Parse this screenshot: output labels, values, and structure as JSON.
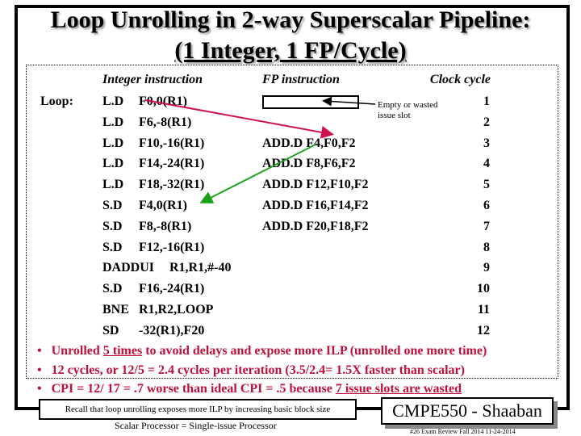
{
  "title_line1": "Loop Unrolling in 2-way Superscalar Pipeline:",
  "title_line2": "(1 Integer, 1 FP/Cycle)",
  "headers": {
    "integer": "Integer instruction",
    "fp": "FP instruction",
    "cycle": "Clock cycle"
  },
  "loop_label": "Loop:",
  "rows": [
    {
      "op": "L.D",
      "args": "F0,0(R1)",
      "fp": "",
      "cycle": "1"
    },
    {
      "op": "L.D",
      "args": "F6,-8(R1)",
      "fp": "",
      "cycle": "2"
    },
    {
      "op": "L.D",
      "args": "F10,-16(R1)",
      "fp": "ADD.D F4,F0,F2",
      "cycle": "3"
    },
    {
      "op": "L.D",
      "args": "F14,-24(R1)",
      "fp": "ADD.D F8,F6,F2",
      "cycle": "4"
    },
    {
      "op": "L.D",
      "args": "F18,-32(R1)",
      "fp": "ADD.D F12,F10,F2",
      "cycle": "5"
    },
    {
      "op": "S.D",
      "args": "F4,0(R1)",
      "fp": "ADD.D F16,F14,F2",
      "cycle": "6"
    },
    {
      "op": "S.D",
      "args": "F8,-8(R1)",
      "fp": "ADD.D F20,F18,F2",
      "cycle": "7"
    },
    {
      "op": "S.D",
      "args": "F12,-16(R1)",
      "fp": "",
      "cycle": "8"
    },
    {
      "op": "DADDUI",
      "args": "R1,R1,#-40",
      "fp": "",
      "cycle": "9"
    },
    {
      "op": "S.D",
      "args": "F16,-24(R1)",
      "fp": "",
      "cycle": "10"
    },
    {
      "op": "BNE",
      "args": "R1,R2,LOOP",
      "fp": "",
      "cycle": "11"
    },
    {
      "op": "SD",
      "args": "-32(R1),F20",
      "fp": "",
      "cycle": "12"
    }
  ],
  "empty_slot_note_1": "Empty or wasted",
  "empty_slot_note_2": "issue slot",
  "bullets": [
    {
      "pre": "Unrolled ",
      "u": "5 times",
      "post": " to avoid delays and expose more ILP (unrolled one more time)"
    },
    {
      "pre": "12 cycles, or 12/5 = 2.4 cycles per iteration (3.5/2.4= 1.5X faster than scalar)",
      "u": "",
      "post": ""
    },
    {
      "pre": "CPI = 12/ 17 = .7  worse than ideal CPI = .5  because ",
      "u": "7 issue slots are wasted",
      "post": ""
    }
  ],
  "recall": "Recall that loop unrolling exposes more ILP by increasing basic block size",
  "brand": "CMPE550 - Shaaban",
  "scalar_note": "Scalar Processor = Single-issue Processor",
  "footer": "#26   Exam Review   Fall 2014   11-24-2014",
  "colors": {
    "bullet_text": "#c0103a",
    "red_arrow": "#d0104a",
    "green_arrow": "#1aa31a"
  }
}
